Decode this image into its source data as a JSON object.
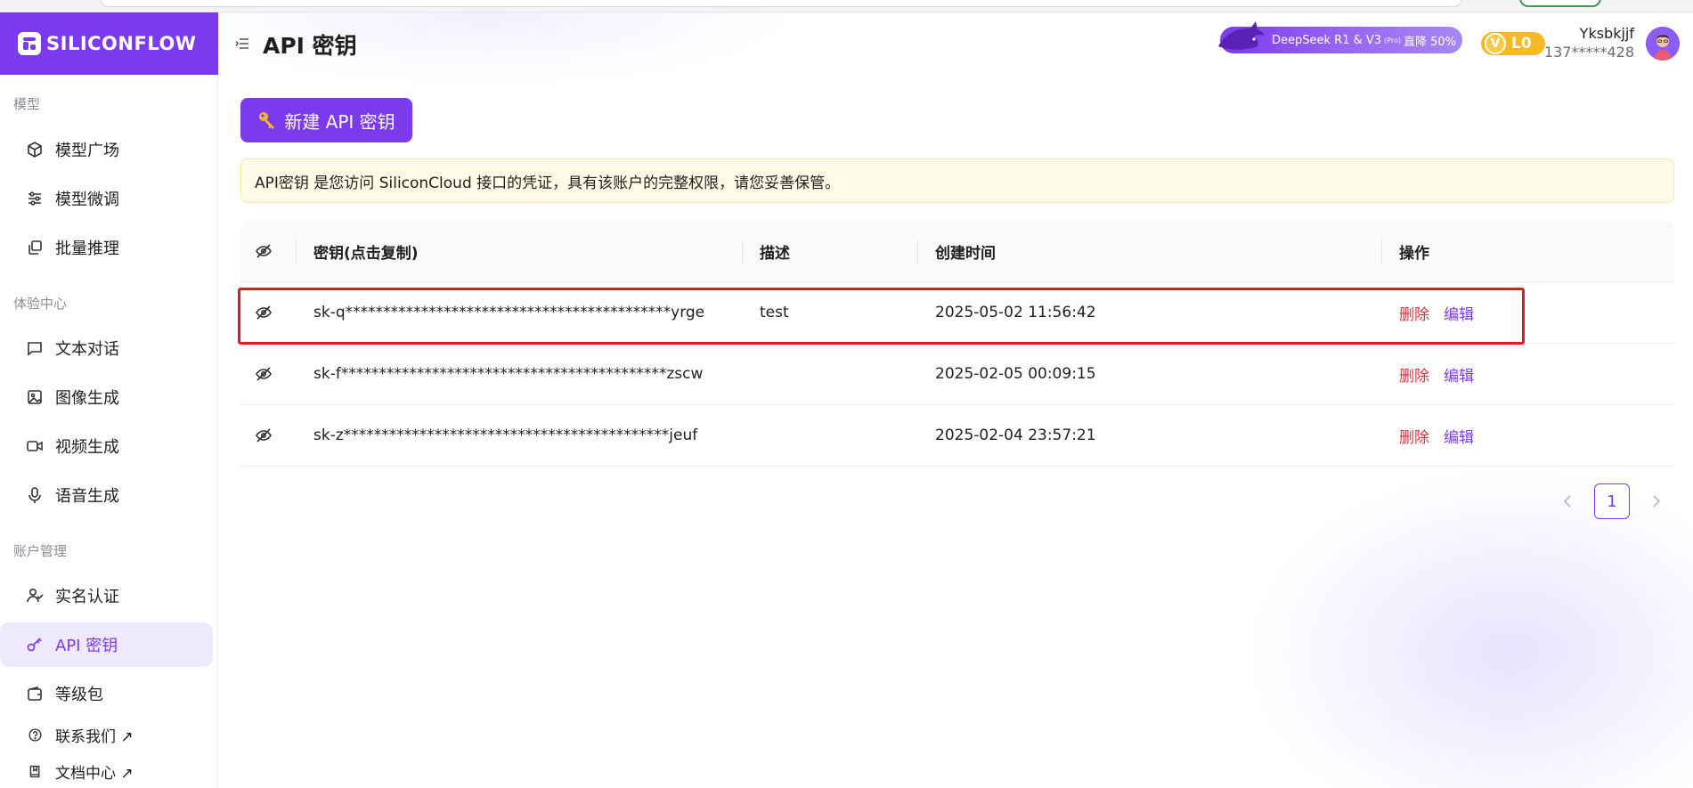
{
  "brand": {
    "logo_text": "SILICONFLOW"
  },
  "header": {
    "title": "API 密钥",
    "promo_prefix": "DeepSeek R1 & V3",
    "promo_tag": "(Pro)",
    "promo_suffix": "直降 50%",
    "level": "L0",
    "level_letter": "V",
    "username": "Yksbkjjf",
    "phone": "137*****428"
  },
  "sidebar": {
    "sections": [
      {
        "label": "模型"
      },
      {
        "label": "体验中心"
      },
      {
        "label": "账户管理"
      }
    ],
    "items": [
      {
        "label": "模型广场",
        "icon": "cube-icon"
      },
      {
        "label": "模型微调",
        "icon": "sliders-icon"
      },
      {
        "label": "批量推理",
        "icon": "copy-stack-icon"
      },
      {
        "label": "文本对话",
        "icon": "chat-icon"
      },
      {
        "label": "图像生成",
        "icon": "image-icon"
      },
      {
        "label": "视频生成",
        "icon": "video-icon"
      },
      {
        "label": "语音生成",
        "icon": "mic-icon"
      },
      {
        "label": "实名认证",
        "icon": "user-check-icon"
      },
      {
        "label": "API 密钥",
        "icon": "key-icon",
        "active": true
      },
      {
        "label": "等级包",
        "icon": "wallet-icon"
      },
      {
        "label": "联系我们 ↗",
        "icon": "help-circle-icon"
      },
      {
        "label": "文档中心 ↗",
        "icon": "book-icon"
      }
    ]
  },
  "actions": {
    "new_key_label": "新建 API 密钥"
  },
  "notice": {
    "text": "API密钥 是您访问 SiliconCloud 接口的凭证，具有该账户的完整权限，请您妥善保管。"
  },
  "table": {
    "headers": {
      "key": "密钥(点击复制)",
      "desc": "描述",
      "created": "创建时间",
      "ops": "操作"
    },
    "rows": [
      {
        "key": "sk-q*******************************************yrge",
        "desc": "test",
        "created": "2025-05-02 11:56:42",
        "delete": "删除",
        "edit": "编辑"
      },
      {
        "key": "sk-f*******************************************zscw",
        "desc": "",
        "created": "2025-02-05 00:09:15",
        "delete": "删除",
        "edit": "编辑"
      },
      {
        "key": "sk-z*******************************************jeuf",
        "desc": "",
        "created": "2025-02-04 23:57:21",
        "delete": "删除",
        "edit": "编辑"
      }
    ]
  },
  "pagination": {
    "current": "1",
    "prev": "‹",
    "next": "›"
  },
  "colors": {
    "accent": "#7c3aed",
    "danger": "#e0323a",
    "highlight": "#e8191d",
    "notice_bg": "#fffbe6"
  }
}
